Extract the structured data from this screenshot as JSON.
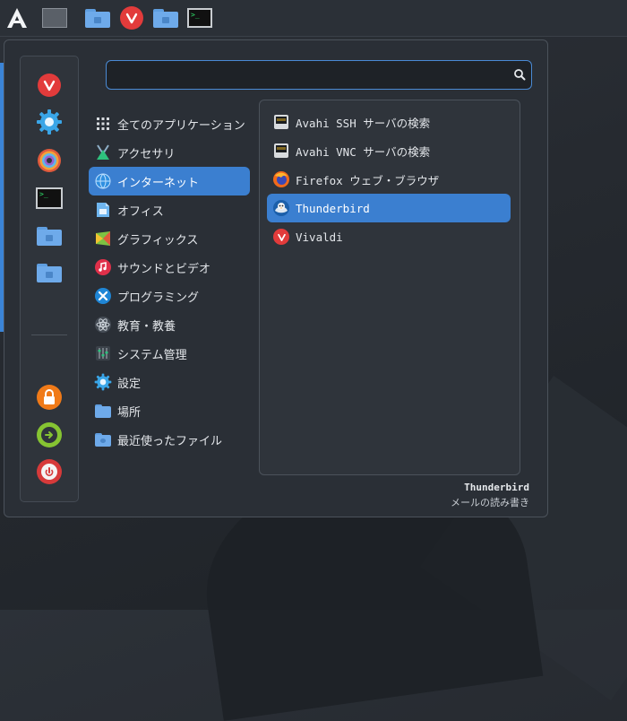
{
  "taskbar": {
    "items": [
      "app-launcher",
      "show-desktop",
      "home-folder",
      "vivaldi",
      "folder",
      "terminal"
    ],
    "terminal_prompt": ">_"
  },
  "search": {
    "value": "",
    "placeholder": ""
  },
  "favorites": {
    "top": [
      "vivaldi",
      "settings",
      "color-picker",
      "terminal",
      "folder",
      "folder"
    ],
    "bottom": [
      "lock",
      "logout",
      "shutdown"
    ]
  },
  "categories": [
    {
      "label": "全てのアプリケーション",
      "icon": "grid-icon"
    },
    {
      "label": "アクセサリ",
      "icon": "accessories-icon"
    },
    {
      "label": "インターネット",
      "icon": "internet-icon",
      "selected": true
    },
    {
      "label": "オフィス",
      "icon": "office-icon"
    },
    {
      "label": "グラフィックス",
      "icon": "graphics-icon"
    },
    {
      "label": "サウンドとビデオ",
      "icon": "music-icon"
    },
    {
      "label": "プログラミング",
      "icon": "programming-icon"
    },
    {
      "label": "教育・教養",
      "icon": "atom-icon"
    },
    {
      "label": "システム管理",
      "icon": "system-icon"
    },
    {
      "label": "設定",
      "icon": "gear-icon"
    },
    {
      "label": "場所",
      "icon": "folder-icon"
    },
    {
      "label": "最近使ったファイル",
      "icon": "recent-folder-icon"
    }
  ],
  "apps": [
    {
      "label": "Avahi SSH サーバの検索",
      "icon": "network-icon"
    },
    {
      "label": "Avahi VNC サーバの検索",
      "icon": "network-icon"
    },
    {
      "label": "Firefox ウェブ・ブラウザ",
      "icon": "firefox-icon"
    },
    {
      "label": "Thunderbird",
      "icon": "thunderbird-icon",
      "selected": true
    },
    {
      "label": "Vivaldi",
      "icon": "vivaldi-icon"
    }
  ],
  "description": {
    "title": "Thunderbird",
    "text": "メールの読み書き"
  },
  "colors": {
    "accent": "#3b7fd0",
    "vivaldi": "#e23b3b",
    "folder": "#6eaaea"
  }
}
